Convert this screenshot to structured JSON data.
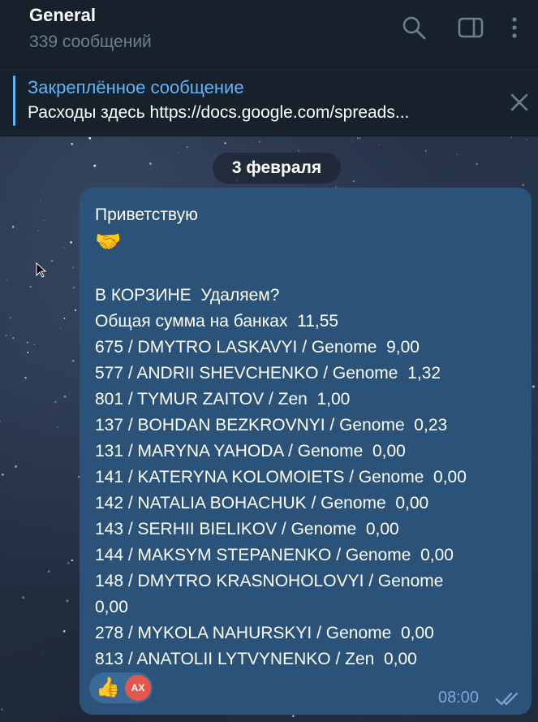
{
  "header": {
    "title": "General",
    "subtitle": "339 сообщений"
  },
  "pinned": {
    "title": "Закреплённое сообщение",
    "text": "Расходы здесь https://docs.google.com/spreads..."
  },
  "date_label": "3 февраля",
  "message": {
    "text": "Приветствую\n\n\nВ КОРЗИНЕ  Удаляем?\nОбщая сумма на банках  11,55\n675 / DMYTRO LASKAVYI / Genome  9,00\n577 / ANDRII SHEVCHENKO / Genome  1,32\n801 / TYMUR ZAITOV / Zen  1,00\n137 / BOHDAN BEZKROVNYI / Genome  0,23\n131 / MARYNA YAHODA / Genome  0,00\n141 / KATERYNA KOLOMOIETS / Genome  0,00\n142 / NATALIA BOHACHUK / Genome  0,00\n143 / SERHII BIELIKOV / Genome  0,00\n144 / MAKSYM STEPANENKO / Genome  0,00\n148 / DMYTRO KRASNOHOLOVYI / Genome\n0,00\n278 / MYKOLA NAHURSKYI / Genome  0,00\n813 / ANATOLII LYTVYNENKO / Zen  0,00",
    "emoji": "🤝",
    "time": "08:00",
    "reaction_emoji": "👍",
    "reaction_user_initials": "AX"
  },
  "colors": {
    "header_bg": "#17212b",
    "accent": "#5eb5f7",
    "bubble_bg": "#2b5278",
    "reaction_avatar": "#e2584d"
  },
  "icons": [
    "search-icon",
    "sidebar-toggle-icon",
    "more-vertical-icon",
    "close-icon",
    "double-check-icon",
    "cursor-icon"
  ]
}
